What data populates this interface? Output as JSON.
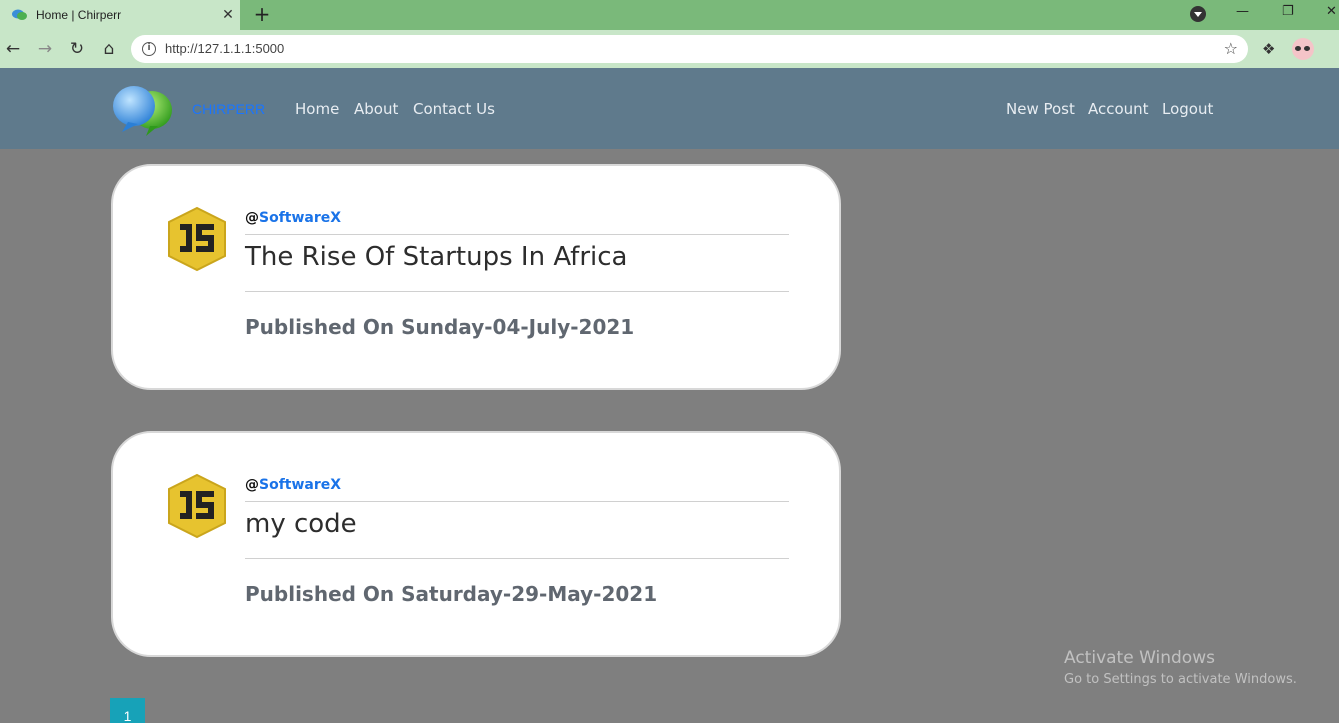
{
  "browser": {
    "tab_title": "Home | Chirperr",
    "tab_close": "✕",
    "new_tab": "+",
    "url": "http://127.1.1.1:5000",
    "window_controls": {
      "minimize": "—",
      "restore": "❐",
      "close": "✕"
    }
  },
  "navbar": {
    "brand": "CHIRPERR",
    "links_left": [
      "Home",
      "About",
      "Contact Us"
    ],
    "links_right": [
      "New Post",
      "Account",
      "Logout"
    ]
  },
  "posts": [
    {
      "at": "@",
      "handle": "SoftwareX",
      "title": "The Rise Of Startups In Africa",
      "published": "Published On Sunday-04-July-2021"
    },
    {
      "at": "@",
      "handle": "SoftwareX",
      "title": "my code",
      "published": "Published On Saturday-29-May-2021"
    }
  ],
  "pagination": {
    "current_page": "1"
  },
  "watermark": {
    "line1": "Activate Windows",
    "line2": "Go to Settings to activate Windows."
  },
  "colors": {
    "page_background": "#7f7f7f",
    "navbar": "#5f7a8c",
    "brand": "#1a75ff",
    "handle": "#1a73e8",
    "pagination": "#17a2b8",
    "browser_frame": "#7ab97a"
  },
  "icons": [
    "back-arrow-icon",
    "forward-arrow-icon",
    "reload-icon",
    "home-icon",
    "site-info-icon",
    "bookmark-star-icon",
    "extensions-puzzle-icon",
    "profile-avatar-icon",
    "chat-bubbles-logo",
    "js-logo-icon"
  ]
}
